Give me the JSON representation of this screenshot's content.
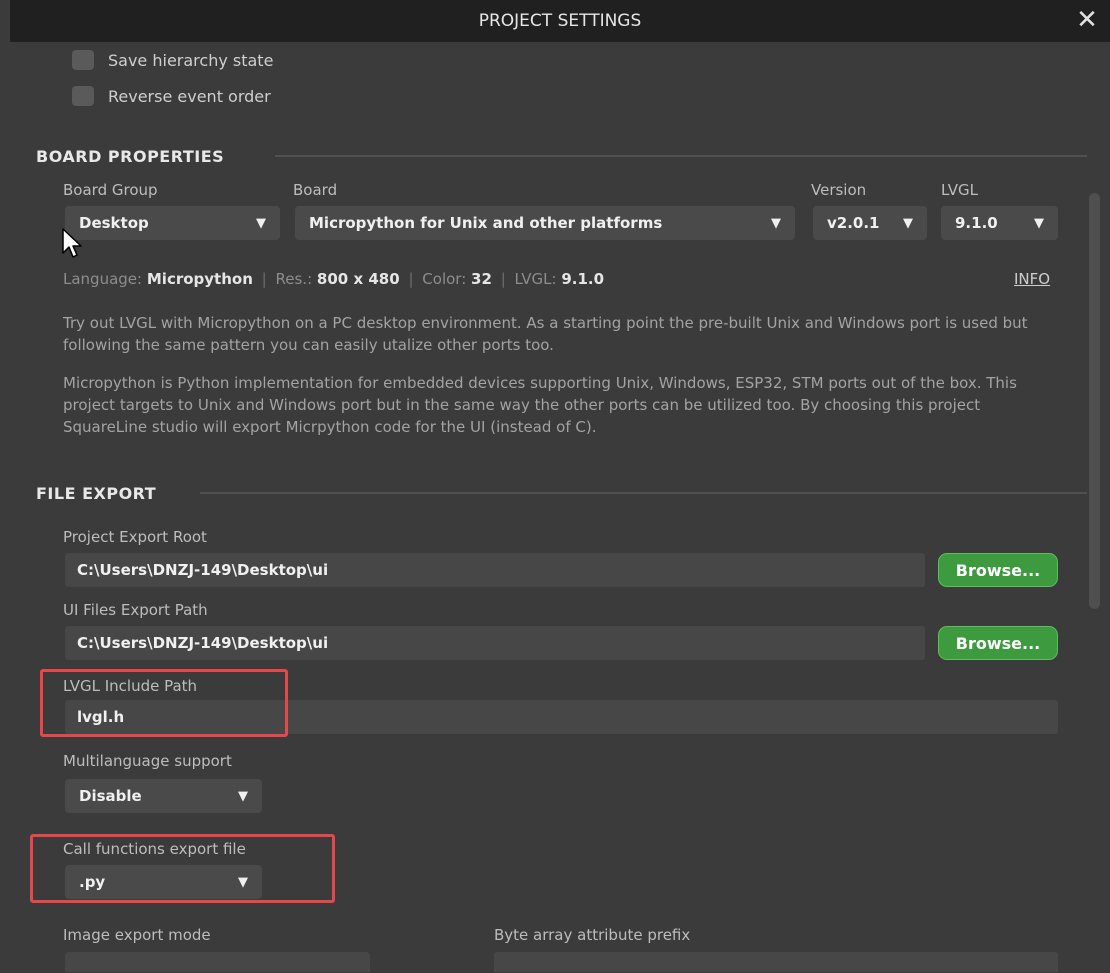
{
  "window": {
    "title": "PROJECT SETTINGS",
    "close_symbol": "✕"
  },
  "options": {
    "save_hierarchy": "Save hierarchy state",
    "reverse_event": "Reverse event order"
  },
  "board_properties": {
    "title": "BOARD PROPERTIES",
    "board_group_label": "Board Group",
    "board_group_value": "Desktop",
    "board_label": "Board",
    "board_value": "Micropython for Unix and other platforms",
    "version_label": "Version",
    "version_value": "v2.0.1",
    "lvgl_label": "LVGL",
    "lvgl_value": "9.1.0",
    "info_line": {
      "language_label": "Language:",
      "language_value": "Micropython",
      "res_label": "Res.:",
      "res_value": "800 x 480",
      "color_label": "Color:",
      "color_value": "32",
      "lvgl_label": "LVGL:",
      "lvgl_value": "9.1.0",
      "separator": "|"
    },
    "info_link": "INFO",
    "description_1": "Try out LVGL with Micropython on a PC desktop environment. As a starting point the pre-built Unix and Windows port is used but following the same pattern you can easily utalize other ports too.",
    "description_2": "Micropython is Python implementation for embedded devices supporting Unix, Windows, ESP32, STM ports out of the box. This project targets to Unix and Windows port but in the same way the other ports can be utilized too. By choosing this project SquareLine studio will export Micrpython code for the UI (instead of C)."
  },
  "file_export": {
    "title": "FILE EXPORT",
    "project_export_root_label": "Project Export Root",
    "project_export_root_value": "C:\\Users\\DNZJ-149\\Desktop\\ui",
    "ui_files_export_path_label": "UI Files Export Path",
    "ui_files_export_path_value": "C:\\Users\\DNZJ-149\\Desktop\\ui",
    "browse_label": "Browse...",
    "lvgl_include_path_label": "LVGL Include Path",
    "lvgl_include_path_value": "lvgl.h",
    "multilanguage_label": "Multilanguage support",
    "multilanguage_value": "Disable",
    "call_functions_label": "Call functions export file",
    "call_functions_value": ".py",
    "image_export_mode_label": "Image export mode",
    "byte_array_prefix_label": "Byte array attribute prefix"
  },
  "dropdown_arrow": "▼",
  "colors": {
    "background": "#3b3b3b",
    "titlebar": "#202020",
    "browse_button": "#3e9a3e",
    "highlight_box": "#e8474a"
  },
  "icons": [
    "close-icon",
    "dropdown-arrow-icon",
    "mouse-cursor-icon"
  ]
}
